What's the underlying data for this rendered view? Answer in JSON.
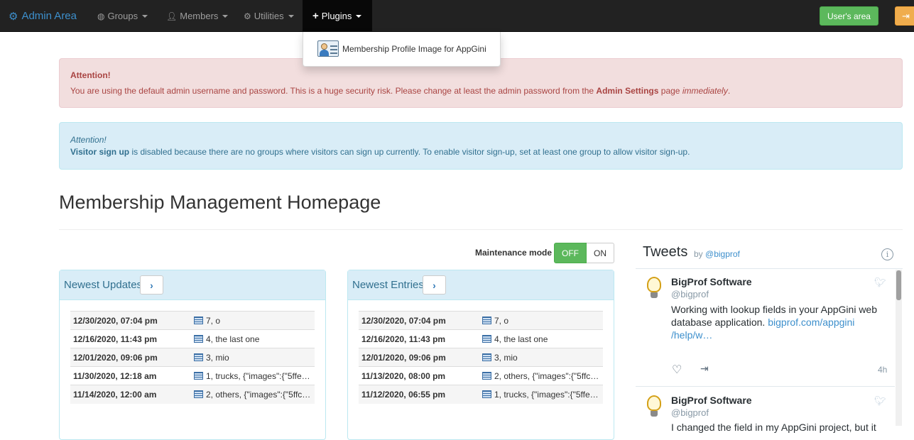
{
  "navbar": {
    "brand": "Admin Area",
    "items": [
      {
        "label": "Groups",
        "icon": "globe-icon"
      },
      {
        "label": "Members",
        "icon": "user-icon"
      },
      {
        "label": "Utilities",
        "icon": "cog-icon"
      },
      {
        "label": "Plugins",
        "icon": "plus-icon"
      }
    ],
    "users_area": "User's area",
    "colors": {
      "bar": "#222222",
      "brand": "#3d8fcc",
      "success": "#5cb85c",
      "warning": "#f0ad4e"
    }
  },
  "plugins_dropdown": {
    "item": "Membership Profile Image for AppGini"
  },
  "alert_danger": {
    "title": "Attention!",
    "text_before": "You are using the default admin username and password. This is a huge security risk. Please change at least the admin password from the ",
    "bold": "Admin Settings",
    "text_middle": " page ",
    "italic": "immediately",
    "text_after": "."
  },
  "alert_info": {
    "title": "Attention!",
    "bold": "Visitor sign up",
    "text": " is disabled because there are no groups where visitors can sign up currently. To enable visitor sign-up, set at least one group to allow visitor sign-up."
  },
  "page_title": "Membership Management Homepage",
  "maintenance": {
    "label": "Maintenance mode",
    "off": "OFF",
    "on": "ON",
    "state": "OFF"
  },
  "newest_updates": {
    "title": "Newest Updates",
    "rows": [
      {
        "date": "12/30/2020, 07:04 pm",
        "record": "7, o"
      },
      {
        "date": "12/16/2020, 11:43 pm",
        "record": "4, the last one"
      },
      {
        "date": "12/01/2020, 09:06 pm",
        "record": "3, mio"
      },
      {
        "date": "11/30/2020, 12:18 am",
        "record": "1, trucks, {\"images\":{\"5ffe…"
      },
      {
        "date": "11/14/2020, 12:00 am",
        "record": "2, others, {\"images\":{\"5ffc…"
      }
    ]
  },
  "newest_entries": {
    "title": "Newest Entries",
    "rows": [
      {
        "date": "12/30/2020, 07:04 pm",
        "record": "7, o"
      },
      {
        "date": "12/16/2020, 11:43 pm",
        "record": "4, the last one"
      },
      {
        "date": "12/01/2020, 09:06 pm",
        "record": "3, mio"
      },
      {
        "date": "11/13/2020, 08:00 pm",
        "record": "2, others, {\"images\":{\"5ffc…"
      },
      {
        "date": "11/12/2020, 06:55 pm",
        "record": "1, trucks, {\"images\":{\"5ffe…"
      }
    ]
  },
  "tweets": {
    "title": "Tweets",
    "by": "by ",
    "handle": "@bigprof",
    "items": [
      {
        "name": "BigProf Software",
        "handle": "@bigprof",
        "text": "Working with lookup fields in your AppGini web database application. ",
        "link": "bigprof.com/appgini /help/w…",
        "time": "4h"
      },
      {
        "name": "BigProf Software",
        "handle": "@bigprof",
        "text": "I changed the field in my AppGini project, but it"
      }
    ]
  }
}
